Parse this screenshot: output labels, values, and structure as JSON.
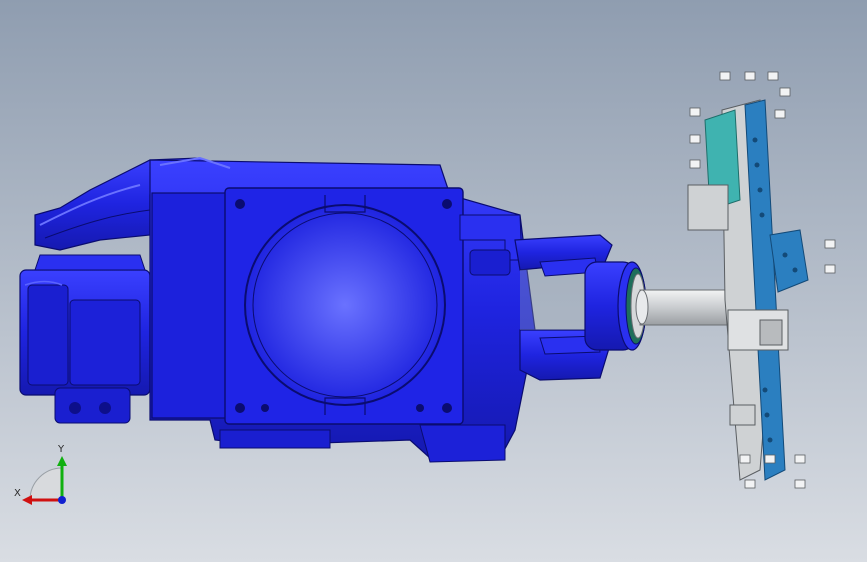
{
  "viewport": {
    "background_top": "#8f9db0",
    "background_bottom": "#d9dde3"
  },
  "model": {
    "body_color": "#1f24e0",
    "body_shadow": "#0d0f8a",
    "body_highlight": "#5a63ff",
    "shaft_color": "#d6d8da",
    "gripper_frame_color": "#cfd2d4",
    "gripper_plate_color": "#2b7fc0",
    "gripper_teal_color": "#3fb3b0",
    "flange_ring_color": "#1e6e5a"
  },
  "triad": {
    "x_label": "X",
    "y_label": "Y",
    "x_color": "#d01010",
    "y_color": "#10b010",
    "z_color": "#1020d0"
  }
}
